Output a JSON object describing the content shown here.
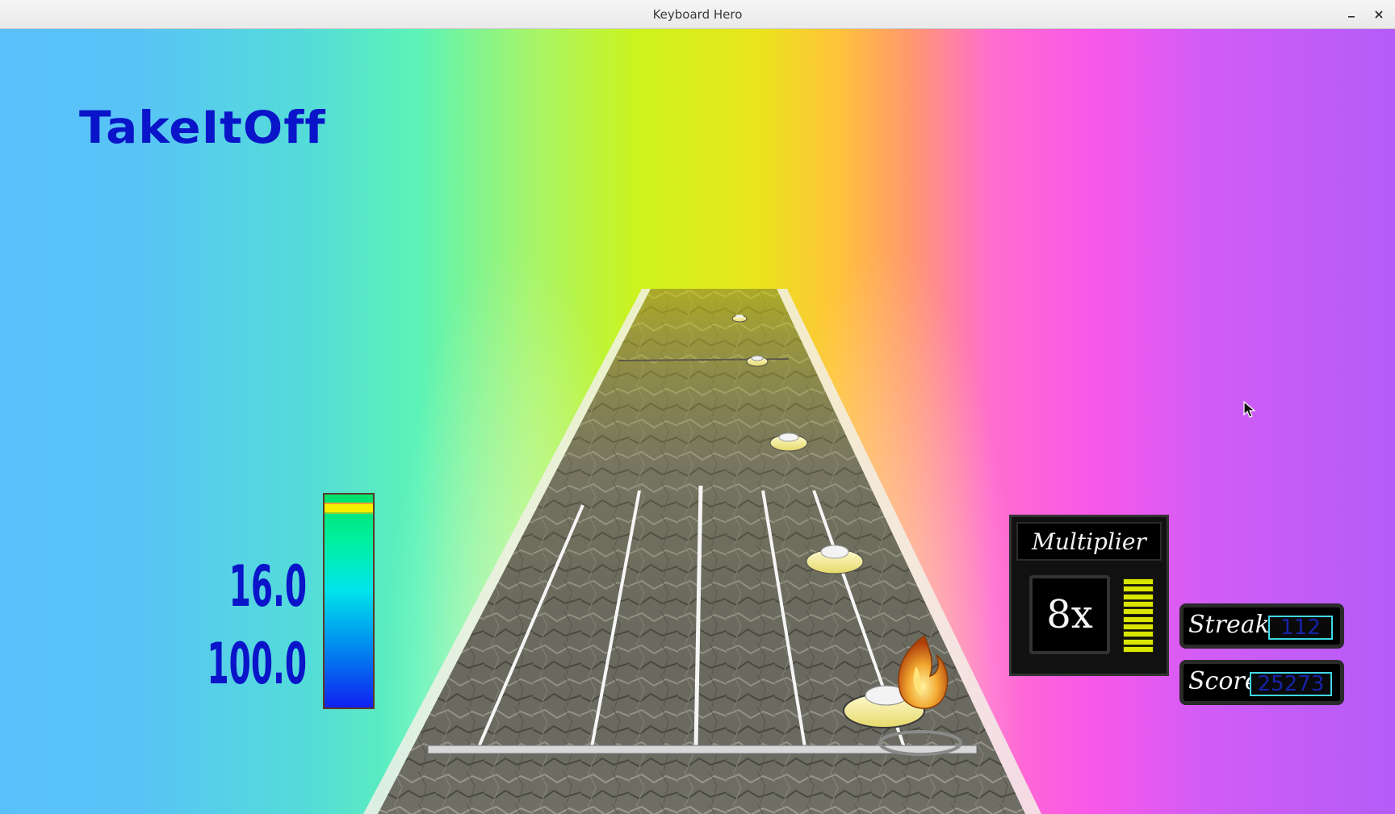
{
  "window": {
    "title": "Keyboard Hero",
    "minimize_icon": "minimize-icon",
    "close_icon": "close-icon"
  },
  "song": {
    "title": "TakeItOff"
  },
  "meters": {
    "top_value": "16.0",
    "bottom_value": "100.0",
    "rock_meter_level": 0.96
  },
  "multiplier": {
    "label": "Multiplier",
    "value": "8x",
    "progress_segments": 10
  },
  "streak": {
    "label": "Streak",
    "value": "112"
  },
  "score": {
    "label": "Score",
    "value": "25273"
  },
  "colors": {
    "hud_text": "#0a14c8",
    "note_yellow": "#f5ee9a",
    "meter_indicator": "#f4f000"
  },
  "icons": [
    "minimize-icon",
    "close-icon",
    "flame-icon",
    "mouse-cursor-icon"
  ]
}
